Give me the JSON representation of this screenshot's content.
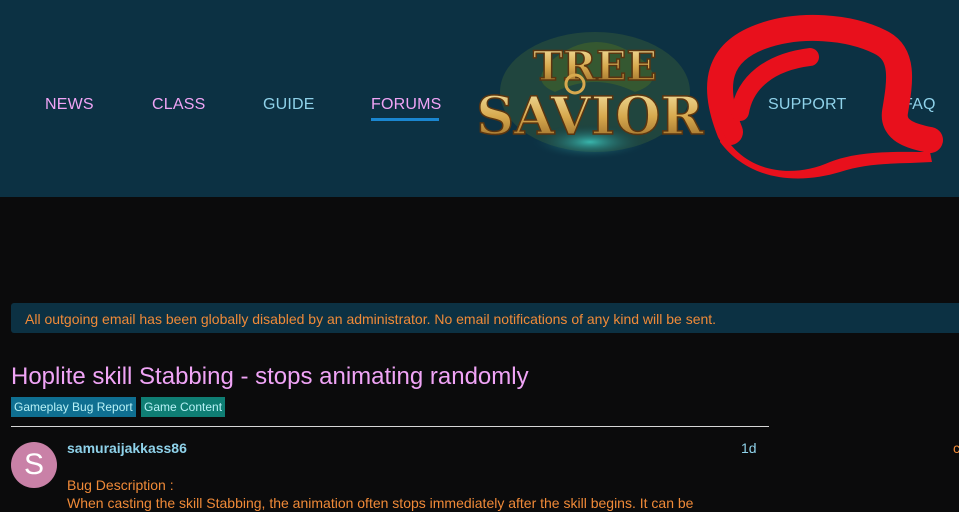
{
  "nav": {
    "items": [
      {
        "label": "NEWS"
      },
      {
        "label": "CLASS"
      },
      {
        "label": "GUIDE"
      },
      {
        "label": "FORUMS",
        "active": true
      },
      {
        "label": "SUPPORT"
      },
      {
        "label": "FAQ"
      }
    ]
  },
  "logo": {
    "line1": "TREE",
    "line2": "SAVIOR"
  },
  "notice": {
    "text": "All outgoing email has been globally disabled by an administrator. No email notifications of any kind will be sent."
  },
  "topic": {
    "title": "Hoplite skill Stabbing - stops animating randomly",
    "tags": [
      "Gameplay Bug Report",
      "Game Content"
    ]
  },
  "post": {
    "avatar_letter": "S",
    "username": "samuraijakkass86",
    "date": "1d",
    "edge_glyph": "c",
    "body_heading": "Bug Description :",
    "body_line1": "When casting the skill Stabbing, the animation often stops immediately after the skill begins. It can be"
  },
  "colors": {
    "header_bg": "#0c3143",
    "page_bg": "#0b0b0c",
    "nav_pink": "#f0a4f6",
    "nav_blue": "#8fd2ea",
    "accent_orange": "#f08a38",
    "tag_bug": "#0f6f91",
    "tag_game": "#0f7e74",
    "avatar": "#c981a7",
    "scribble_red": "#e8101c"
  }
}
